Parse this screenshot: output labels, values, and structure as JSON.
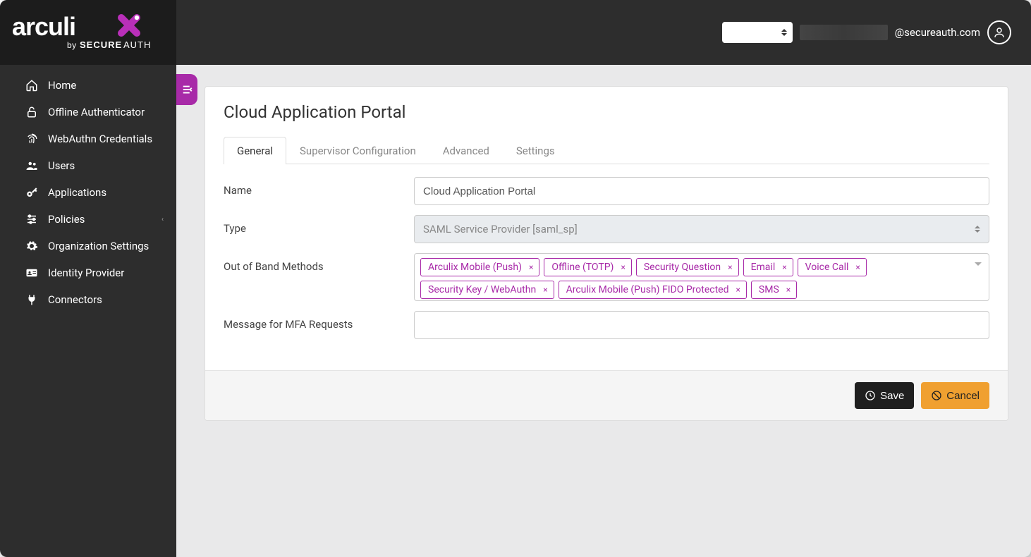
{
  "header": {
    "user_email_suffix": "@secureauth.com"
  },
  "sidebar": {
    "items": [
      {
        "label": "Home",
        "icon": "home-icon"
      },
      {
        "label": "Offline Authenticator",
        "icon": "lock-open-icon"
      },
      {
        "label": "WebAuthn Credentials",
        "icon": "fingerprint-icon"
      },
      {
        "label": "Users",
        "icon": "users-icon"
      },
      {
        "label": "Applications",
        "icon": "key-icon"
      },
      {
        "label": "Policies",
        "icon": "sliders-icon",
        "has_children": true
      },
      {
        "label": "Organization Settings",
        "icon": "gear-icon"
      },
      {
        "label": "Identity Provider",
        "icon": "id-card-icon"
      },
      {
        "label": "Connectors",
        "icon": "plug-icon"
      }
    ]
  },
  "page": {
    "title": "Cloud Application Portal",
    "tabs": [
      {
        "label": "General",
        "active": true
      },
      {
        "label": "Supervisor Configuration"
      },
      {
        "label": "Advanced"
      },
      {
        "label": "Settings"
      }
    ],
    "form": {
      "name_label": "Name",
      "name_value": "Cloud Application Portal",
      "type_label": "Type",
      "type_value": "SAML Service Provider [saml_sp]",
      "oob_label": "Out of Band Methods",
      "oob_tags": [
        "Arculix Mobile (Push)",
        "Offline (TOTP)",
        "Security Question",
        "Email",
        "Voice Call",
        "Security Key / WebAuthn",
        "Arculix Mobile (Push) FIDO Protected",
        "SMS"
      ],
      "mfa_label": "Message for MFA Requests",
      "mfa_value": ""
    },
    "actions": {
      "save": "Save",
      "cancel": "Cancel"
    }
  }
}
